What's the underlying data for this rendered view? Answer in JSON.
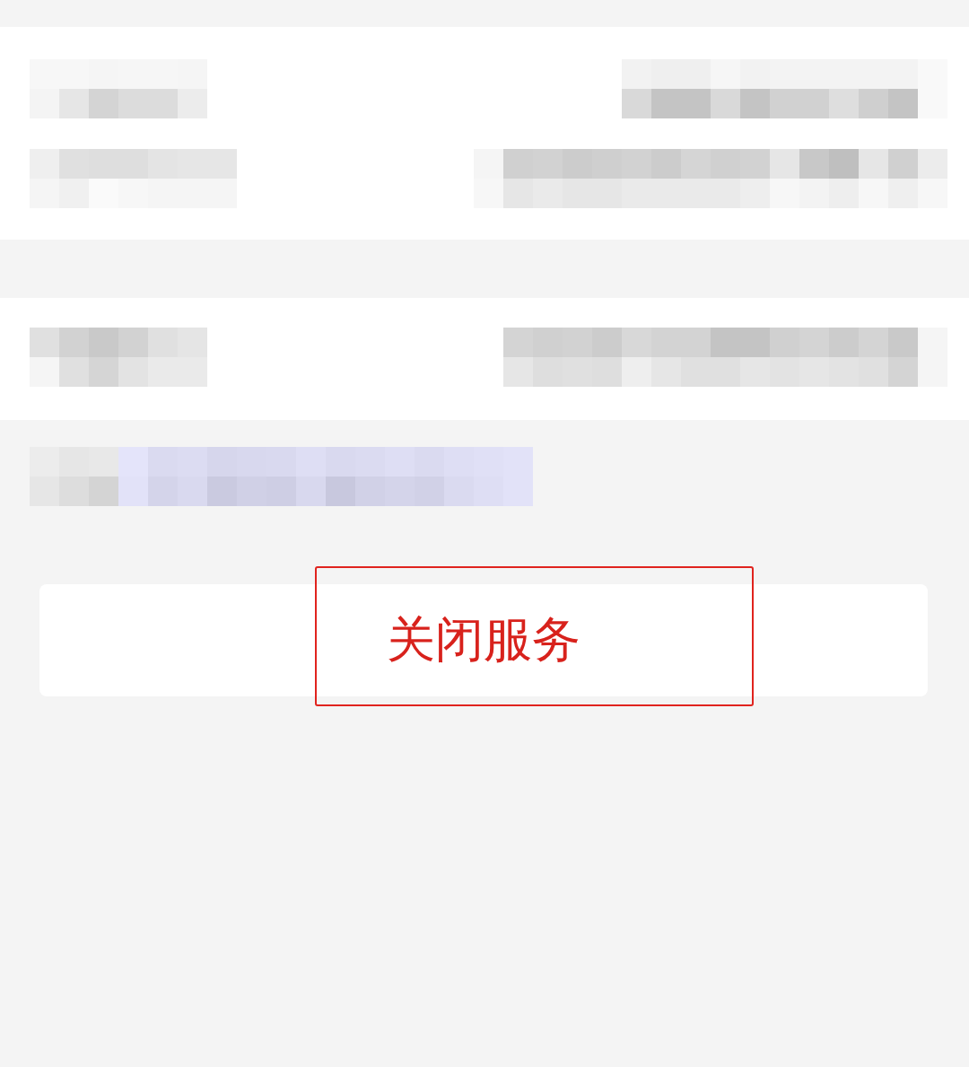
{
  "sections": [
    {
      "rows": [
        {
          "label": {
            "kind": "pixelated"
          },
          "value": {
            "kind": "pixelated"
          }
        },
        {
          "label": {
            "kind": "pixelated"
          },
          "value": {
            "kind": "pixelated"
          }
        }
      ]
    },
    {
      "rows": [
        {
          "label": {
            "kind": "pixelated"
          },
          "value": {
            "kind": "pixelated"
          }
        }
      ]
    }
  ],
  "note": {
    "kind": "pixelated_link"
  },
  "button": {
    "label": "关闭服务",
    "highlighted": true
  }
}
